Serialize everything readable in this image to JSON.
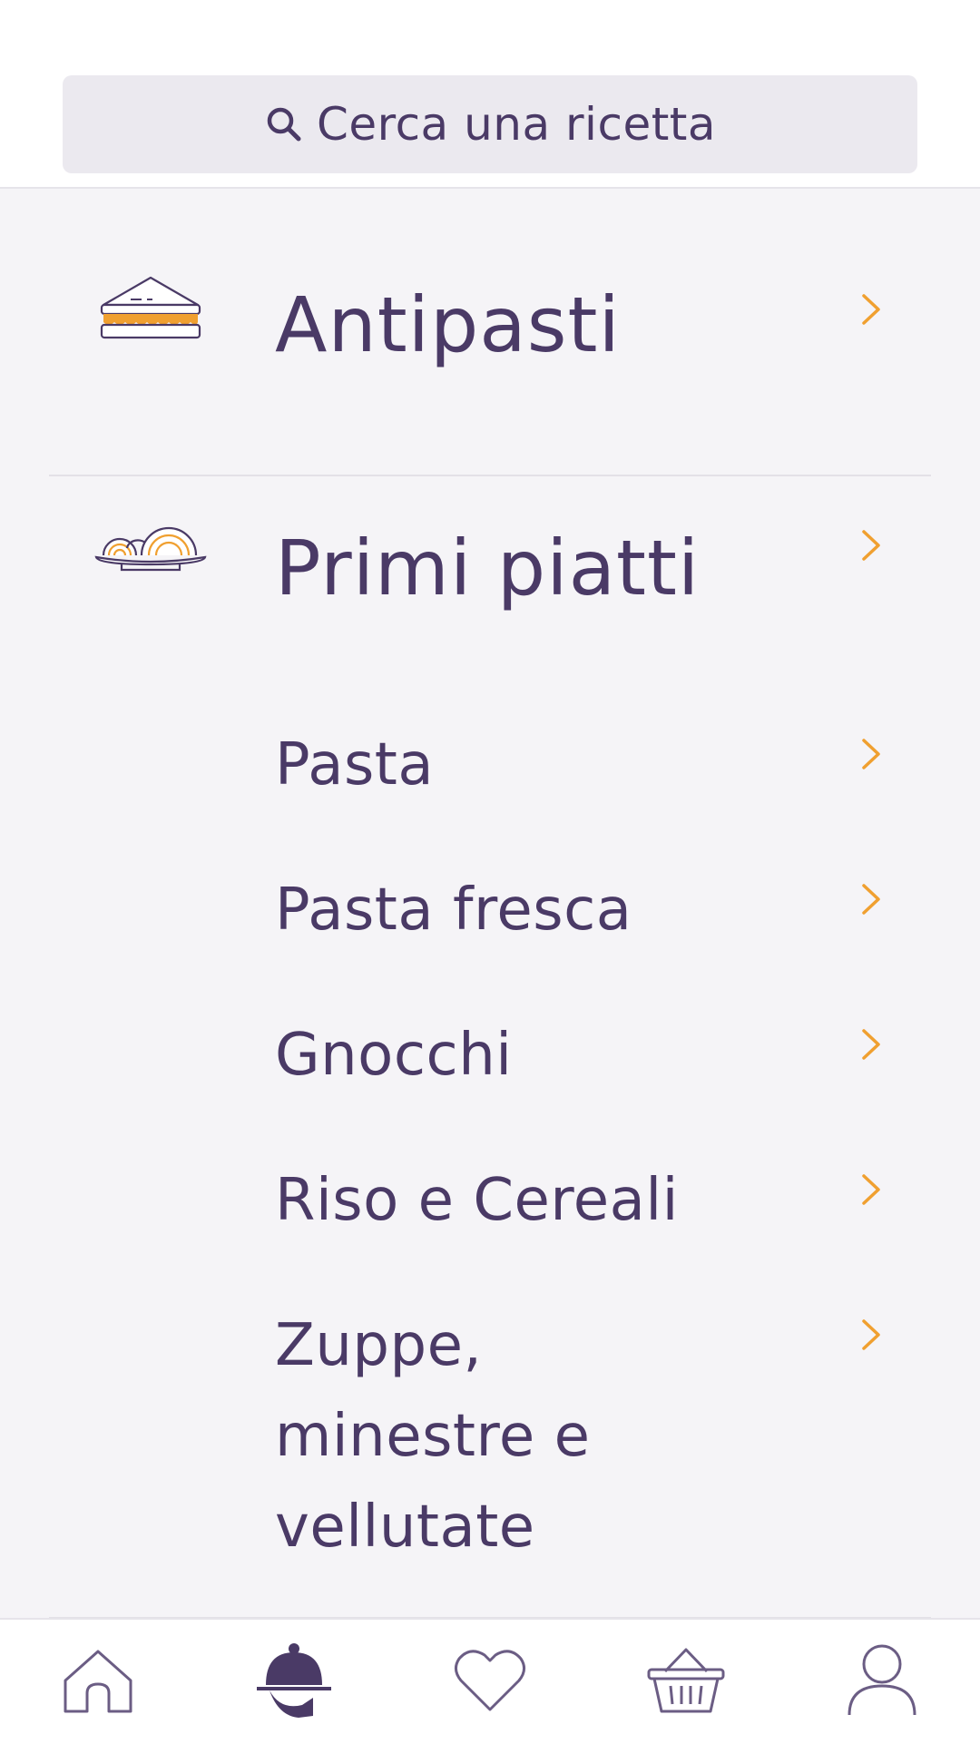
{
  "search": {
    "placeholder": "Cerca una ricetta",
    "icon": "search-icon"
  },
  "categories": [
    {
      "label": "Antipasti",
      "icon": "sandwich-icon",
      "subcategories": []
    },
    {
      "label": "Primi piatti",
      "icon": "pasta-plate-icon",
      "subcategories": [
        {
          "label": "Pasta"
        },
        {
          "label": "Pasta fresca"
        },
        {
          "label": "Gnocchi"
        },
        {
          "label": "Riso e Cereali"
        },
        {
          "label": "Zuppe, minestre e vellutate"
        }
      ]
    }
  ],
  "bottom_nav": {
    "items": [
      {
        "name": "home",
        "icon": "home-icon",
        "active": false
      },
      {
        "name": "recipes",
        "icon": "chef-hat-icon",
        "active": true
      },
      {
        "name": "favorites",
        "icon": "heart-icon",
        "active": false
      },
      {
        "name": "basket",
        "icon": "basket-icon",
        "active": false
      },
      {
        "name": "profile",
        "icon": "user-icon",
        "active": false
      }
    ]
  },
  "colors": {
    "primary": "#4a3a66",
    "accent": "#f0a030",
    "background": "#f5f4f7",
    "search_bg": "#ebe9ef"
  }
}
